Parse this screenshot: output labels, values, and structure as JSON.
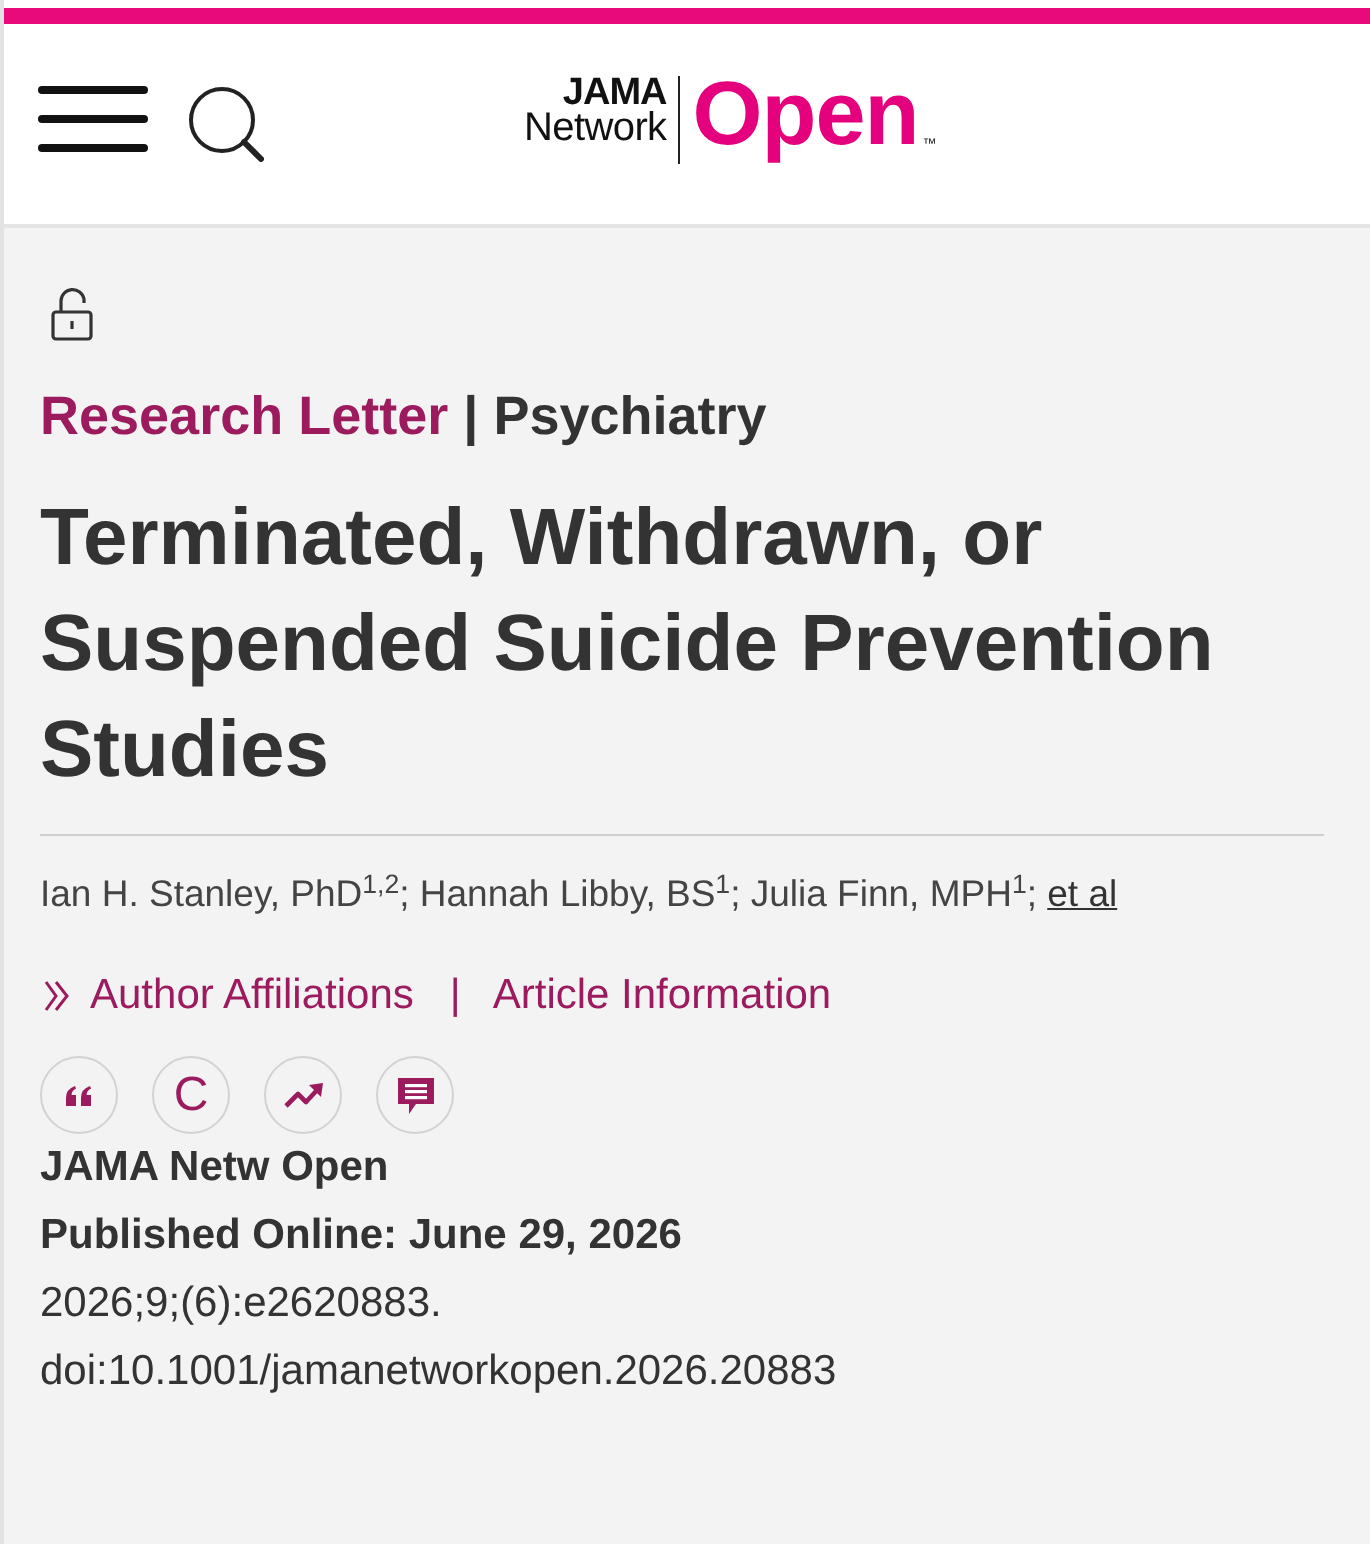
{
  "header": {
    "logo": {
      "top": "JAMA",
      "bottom": "Network",
      "wordmark": "Open",
      "mark": "™"
    }
  },
  "article": {
    "open_access": true,
    "type": "Research Letter",
    "separator": "|",
    "subject": "Psychiatry",
    "title": "Terminated, Withdrawn, or Suspended Suicide Prevention Studies",
    "authors": "Ian H. Stanley, PhD$^{1,2}$; Hannah Libby, BS$^{1}$; Julia Finn, MPH$^{1}$;",
    "authors_more": "et al",
    "links": [
      {
        "label": "Author Affiliations",
        "kind": "expand"
      },
      {
        "label": "Article Information",
        "kind": "plain"
      }
    ],
    "link_separator": "|",
    "tools": [
      {
        "kind": "quote"
      },
      {
        "kind": "letter",
        "label": "C"
      },
      {
        "kind": "trend"
      },
      {
        "kind": "comment"
      }
    ],
    "journal": "JAMA Netw Open",
    "published": "Published Online: June 29, 2026",
    "citation": "2026;9;(6):e2620883.",
    "doi": "doi:10.1001/jamanetworkopen.2026.20883"
  }
}
